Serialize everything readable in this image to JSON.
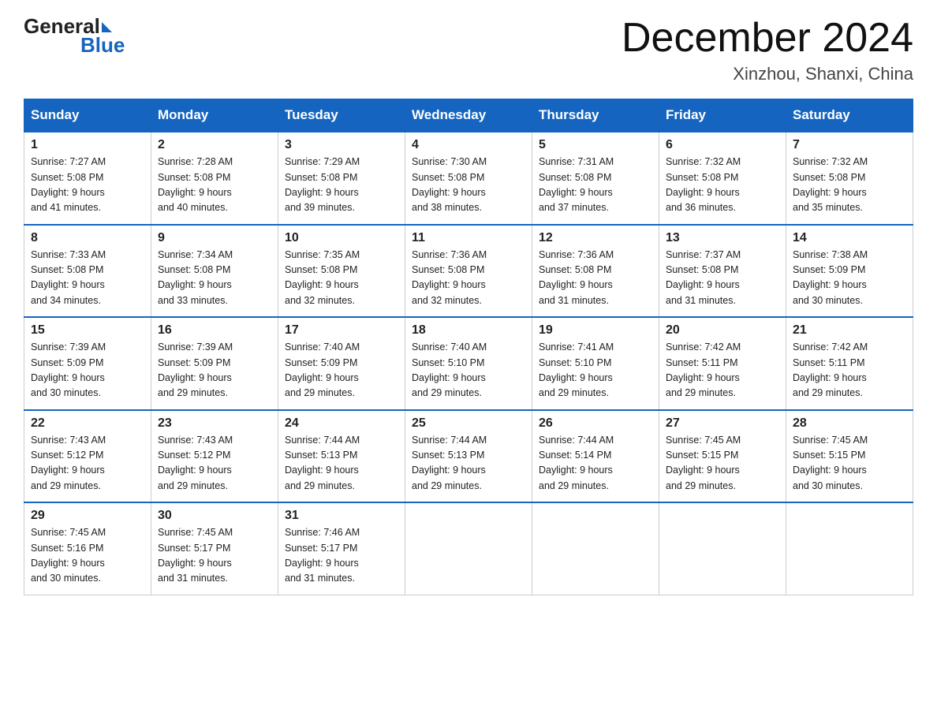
{
  "logo": {
    "general": "General",
    "blue": "Blue"
  },
  "title": "December 2024",
  "location": "Xinzhou, Shanxi, China",
  "days_of_week": [
    "Sunday",
    "Monday",
    "Tuesday",
    "Wednesday",
    "Thursday",
    "Friday",
    "Saturday"
  ],
  "weeks": [
    [
      {
        "day": "1",
        "sunrise": "7:27 AM",
        "sunset": "5:08 PM",
        "daylight": "9 hours and 41 minutes."
      },
      {
        "day": "2",
        "sunrise": "7:28 AM",
        "sunset": "5:08 PM",
        "daylight": "9 hours and 40 minutes."
      },
      {
        "day": "3",
        "sunrise": "7:29 AM",
        "sunset": "5:08 PM",
        "daylight": "9 hours and 39 minutes."
      },
      {
        "day": "4",
        "sunrise": "7:30 AM",
        "sunset": "5:08 PM",
        "daylight": "9 hours and 38 minutes."
      },
      {
        "day": "5",
        "sunrise": "7:31 AM",
        "sunset": "5:08 PM",
        "daylight": "9 hours and 37 minutes."
      },
      {
        "day": "6",
        "sunrise": "7:32 AM",
        "sunset": "5:08 PM",
        "daylight": "9 hours and 36 minutes."
      },
      {
        "day": "7",
        "sunrise": "7:32 AM",
        "sunset": "5:08 PM",
        "daylight": "9 hours and 35 minutes."
      }
    ],
    [
      {
        "day": "8",
        "sunrise": "7:33 AM",
        "sunset": "5:08 PM",
        "daylight": "9 hours and 34 minutes."
      },
      {
        "day": "9",
        "sunrise": "7:34 AM",
        "sunset": "5:08 PM",
        "daylight": "9 hours and 33 minutes."
      },
      {
        "day": "10",
        "sunrise": "7:35 AM",
        "sunset": "5:08 PM",
        "daylight": "9 hours and 32 minutes."
      },
      {
        "day": "11",
        "sunrise": "7:36 AM",
        "sunset": "5:08 PM",
        "daylight": "9 hours and 32 minutes."
      },
      {
        "day": "12",
        "sunrise": "7:36 AM",
        "sunset": "5:08 PM",
        "daylight": "9 hours and 31 minutes."
      },
      {
        "day": "13",
        "sunrise": "7:37 AM",
        "sunset": "5:08 PM",
        "daylight": "9 hours and 31 minutes."
      },
      {
        "day": "14",
        "sunrise": "7:38 AM",
        "sunset": "5:09 PM",
        "daylight": "9 hours and 30 minutes."
      }
    ],
    [
      {
        "day": "15",
        "sunrise": "7:39 AM",
        "sunset": "5:09 PM",
        "daylight": "9 hours and 30 minutes."
      },
      {
        "day": "16",
        "sunrise": "7:39 AM",
        "sunset": "5:09 PM",
        "daylight": "9 hours and 29 minutes."
      },
      {
        "day": "17",
        "sunrise": "7:40 AM",
        "sunset": "5:09 PM",
        "daylight": "9 hours and 29 minutes."
      },
      {
        "day": "18",
        "sunrise": "7:40 AM",
        "sunset": "5:10 PM",
        "daylight": "9 hours and 29 minutes."
      },
      {
        "day": "19",
        "sunrise": "7:41 AM",
        "sunset": "5:10 PM",
        "daylight": "9 hours and 29 minutes."
      },
      {
        "day": "20",
        "sunrise": "7:42 AM",
        "sunset": "5:11 PM",
        "daylight": "9 hours and 29 minutes."
      },
      {
        "day": "21",
        "sunrise": "7:42 AM",
        "sunset": "5:11 PM",
        "daylight": "9 hours and 29 minutes."
      }
    ],
    [
      {
        "day": "22",
        "sunrise": "7:43 AM",
        "sunset": "5:12 PM",
        "daylight": "9 hours and 29 minutes."
      },
      {
        "day": "23",
        "sunrise": "7:43 AM",
        "sunset": "5:12 PM",
        "daylight": "9 hours and 29 minutes."
      },
      {
        "day": "24",
        "sunrise": "7:44 AM",
        "sunset": "5:13 PM",
        "daylight": "9 hours and 29 minutes."
      },
      {
        "day": "25",
        "sunrise": "7:44 AM",
        "sunset": "5:13 PM",
        "daylight": "9 hours and 29 minutes."
      },
      {
        "day": "26",
        "sunrise": "7:44 AM",
        "sunset": "5:14 PM",
        "daylight": "9 hours and 29 minutes."
      },
      {
        "day": "27",
        "sunrise": "7:45 AM",
        "sunset": "5:15 PM",
        "daylight": "9 hours and 29 minutes."
      },
      {
        "day": "28",
        "sunrise": "7:45 AM",
        "sunset": "5:15 PM",
        "daylight": "9 hours and 30 minutes."
      }
    ],
    [
      {
        "day": "29",
        "sunrise": "7:45 AM",
        "sunset": "5:16 PM",
        "daylight": "9 hours and 30 minutes."
      },
      {
        "day": "30",
        "sunrise": "7:45 AM",
        "sunset": "5:17 PM",
        "daylight": "9 hours and 31 minutes."
      },
      {
        "day": "31",
        "sunrise": "7:46 AM",
        "sunset": "5:17 PM",
        "daylight": "9 hours and 31 minutes."
      },
      null,
      null,
      null,
      null
    ]
  ],
  "labels": {
    "sunrise": "Sunrise:",
    "sunset": "Sunset:",
    "daylight": "Daylight:"
  }
}
